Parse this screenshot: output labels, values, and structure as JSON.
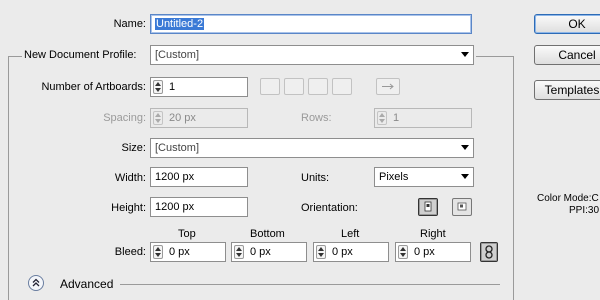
{
  "dialog": {
    "name_label": "Name:",
    "name_value": "Untitled-2",
    "profile_label": "New Document Profile:",
    "profile_value": "[Custom]",
    "artboards_label": "Number of Artboards:",
    "artboards_value": "1",
    "spacing_label": "Spacing:",
    "spacing_value": "20 px",
    "rows_label": "Rows:",
    "rows_value": "1",
    "size_label": "Size:",
    "size_value": "[Custom]",
    "width_label": "Width:",
    "width_value": "1200 px",
    "units_label": "Units:",
    "units_value": "Pixels",
    "height_label": "Height:",
    "height_value": "1200 px",
    "orientation_label": "Orientation:",
    "bleed_label": "Bleed:",
    "bleed_top_label": "Top",
    "bleed_bottom_label": "Bottom",
    "bleed_left_label": "Left",
    "bleed_right_label": "Right",
    "bleed_top": "0 px",
    "bleed_bottom": "0 px",
    "bleed_left": "0 px",
    "bleed_right": "0 px",
    "advanced_label": "Advanced"
  },
  "buttons": {
    "ok": "OK",
    "cancel": "Cancel",
    "templates": "Templates..."
  },
  "info": {
    "color_mode": "Color Mode:C",
    "ppi": "PPI:30"
  },
  "icons": [
    "grid-by-row-icon",
    "grid-by-column-icon",
    "arrange-by-row-icon",
    "arrange-by-column-icon",
    "right-to-left-icon",
    "portrait-icon",
    "landscape-icon",
    "link-bleed-icon",
    "chevron-up-icon"
  ],
  "colors": {
    "background": "#ebebeb",
    "selection": "#3b7ad6",
    "default_button_border": "#2d6bb6"
  }
}
